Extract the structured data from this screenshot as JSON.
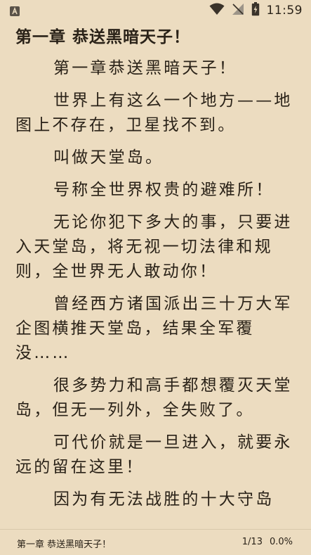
{
  "status_bar": {
    "app_icon": "app-notification-icon",
    "wifi_icon": "wifi-icon",
    "signal_icon": "signal-off-icon",
    "battery_icon": "battery-charging-icon",
    "time": "11:59"
  },
  "reader": {
    "chapter_title": "第一章 恭送黑暗天子！",
    "paragraphs": [
      "第一章恭送黑暗天子！",
      "世界上有这么一个地方——地图上不存在，卫星找不到。",
      "叫做天堂岛。",
      "号称全世界权贵的避难所！",
      "无论你犯下多大的事，只要进入天堂岛，将无视一切法律和规则，全世界无人敢动你！",
      "曾经西方诸国派出三十万大军企图横推天堂岛，结果全军覆没……",
      "很多势力和高手都想覆灭天堂岛，但无一列外，全失败了。",
      "可代价就是一旦进入，就要永远的留在这里！",
      "因为有无法战胜的十大守岛"
    ]
  },
  "footer": {
    "chapter_title": "第一章 恭送黑暗天子！",
    "page": "1/13",
    "percent": "0.0%"
  }
}
